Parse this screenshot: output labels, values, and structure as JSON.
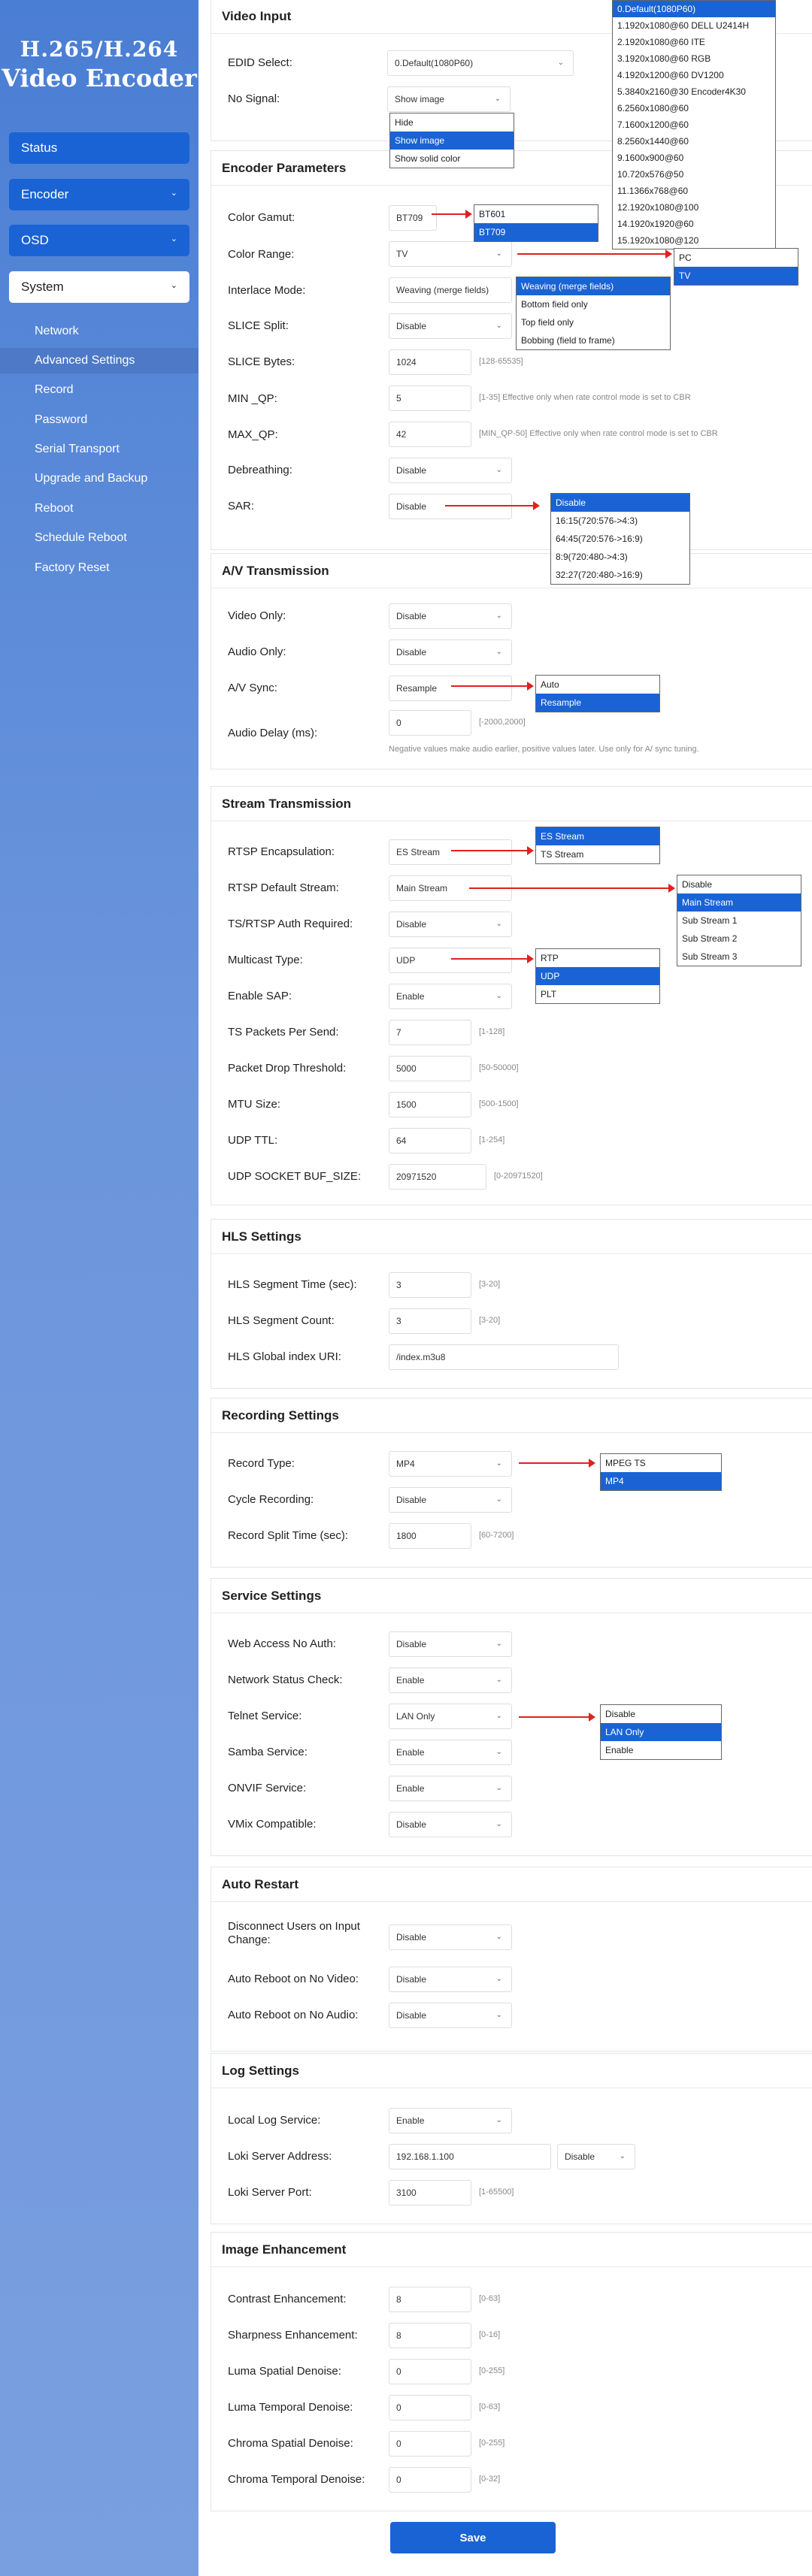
{
  "brand": {
    "line1": "H.265/H.264",
    "line2": "Video Encoder"
  },
  "nav": {
    "status": "Status",
    "encoder": "Encoder",
    "osd": "OSD",
    "system": "System",
    "sub": [
      "Network",
      "Advanced Settings",
      "Record",
      "Password",
      "Serial Transport",
      "Upgrade and Backup",
      "Reboot",
      "Schedule Reboot",
      "Factory Reset"
    ]
  },
  "video_input": {
    "title": "Video Input",
    "edid_label": "EDID Select:",
    "edid_value": "0.Default(1080P60)",
    "nosignal_label": "No Signal:",
    "nosignal_value": "Show image",
    "edid_options": [
      "0.Default(1080P60)",
      "1.1920x1080@60 DELL U2414H",
      "2.1920x1080@60 ITE",
      "3.1920x1080@60 RGB",
      "4.1920x1200@60 DV1200",
      "5.3840x2160@30 Encoder4K30",
      "6.2560x1080@60",
      "7.1600x1200@60",
      "8.2560x1440@60",
      "9.1600x900@60",
      "10.720x576@50",
      "11.1366x768@60",
      "12.1920x1080@100",
      "14.1920x1920@60",
      "15.1920x1080@120"
    ],
    "nosignal_options": [
      "Hide",
      "Show image",
      "Show solid color"
    ]
  },
  "encoder": {
    "title": "Encoder Parameters",
    "gamut_label": "Color Gamut:",
    "gamut_value": "BT709",
    "gamut_options": [
      "BT601",
      "BT709"
    ],
    "range_label": "Color Range:",
    "range_value": "TV",
    "range_options": [
      "PC",
      "TV"
    ],
    "interlace_label": "Interlace Mode:",
    "interlace_value": "Weaving (merge fields)",
    "interlace_options": [
      "Weaving (merge fields)",
      "Bottom field only",
      "Top field only",
      "Bobbing (field to frame)"
    ],
    "slice_label": "SLICE Split:",
    "slice_value": "Disable",
    "slicebytes_label": "SLICE Bytes:",
    "slicebytes_value": "1024",
    "slicebytes_hint": "[128-65535]",
    "minqp_label": "MIN _QP:",
    "minqp_value": "5",
    "minqp_hint": "[1-35]  Effective only when rate control mode is set to CBR",
    "maxqp_label": "MAX_QP:",
    "maxqp_value": "42",
    "maxqp_hint": "[MIN_QP-50]  Effective only when rate control mode is set to CBR",
    "debreath_label": "Debreathing:",
    "debreath_value": "Disable",
    "sar_label": "SAR:",
    "sar_value": "Disable",
    "sar_options": [
      "Disable",
      "16:15(720:576->4:3)",
      "64:45(720:576->16:9)",
      "8:9(720:480->4:3)",
      "32:27(720:480->16:9)"
    ]
  },
  "av": {
    "title": "A/V Transmission",
    "video_only_label": "Video Only:",
    "video_only_value": "Disable",
    "audio_only_label": "Audio Only:",
    "audio_only_value": "Disable",
    "sync_label": "A/V Sync:",
    "sync_value": "Resample",
    "sync_options": [
      "Auto",
      "Resample"
    ],
    "delay_label": "Audio Delay (ms):",
    "delay_value": "0",
    "delay_hint": "[-2000,2000]",
    "delay_note": "Negative values make audio earlier, positive values later. Use only for A/ sync tuning."
  },
  "stream": {
    "title": "Stream Transmission",
    "rtsp_encap_label": "RTSP Encapsulation:",
    "rtsp_encap_value": "ES Stream",
    "rtsp_encap_options": [
      "ES Stream",
      "TS Stream"
    ],
    "rtsp_default_label": "RTSP Default Stream:",
    "rtsp_default_value": "Main Stream",
    "rtsp_default_options": [
      "Disable",
      "Main Stream",
      "Sub Stream 1",
      "Sub Stream 2",
      "Sub Stream 3"
    ],
    "auth_label": "TS/RTSP Auth Required:",
    "auth_value": "Disable",
    "multicast_label": "Multicast Type:",
    "multicast_value": "UDP",
    "multicast_options": [
      "RTP",
      "UDP",
      "PLT"
    ],
    "sap_label": "Enable SAP:",
    "sap_value": "Enable",
    "tspkt_label": "TS Packets Per Send:",
    "tspkt_value": "7",
    "tspkt_hint": "[1-128]",
    "drop_label": "Packet Drop Threshold:",
    "drop_value": "5000",
    "drop_hint": "[50-50000]",
    "mtu_label": "MTU Size:",
    "mtu_value": "1500",
    "mtu_hint": "[500-1500]",
    "ttl_label": "UDP TTL:",
    "ttl_value": "64",
    "ttl_hint": "[1-254]",
    "buf_label": "UDP SOCKET BUF_SIZE:",
    "buf_value": "20971520",
    "buf_hint": "[0-20971520]"
  },
  "hls": {
    "title": "HLS Settings",
    "seg_time_label": "HLS Segment Time (sec):",
    "seg_time_value": "3",
    "seg_time_hint": "[3-20]",
    "seg_count_label": "HLS Segment Count:",
    "seg_count_value": "3",
    "seg_count_hint": "[3-20]",
    "uri_label": "HLS Global index URI:",
    "uri_value": "/index.m3u8"
  },
  "recording": {
    "title": "Recording Settings",
    "type_label": "Record Type:",
    "type_value": "MP4",
    "type_options": [
      "MPEG TS",
      "MP4"
    ],
    "cycle_label": "Cycle Recording:",
    "cycle_value": "Disable",
    "split_label": "Record Split Time (sec):",
    "split_value": "1800",
    "split_hint": "[60-7200]"
  },
  "service": {
    "title": "Service Settings",
    "web_label": "Web Access No Auth:",
    "web_value": "Disable",
    "netcheck_label": "Network Status Check:",
    "netcheck_value": "Enable",
    "telnet_label": "Telnet Service:",
    "telnet_value": "LAN Only",
    "telnet_options": [
      "Disable",
      "LAN Only",
      "Enable"
    ],
    "samba_label": "Samba Service:",
    "samba_value": "Enable",
    "onvif_label": "ONVIF Service:",
    "onvif_value": "Enable",
    "vmix_label": "VMix Compatible:",
    "vmix_value": "Disable"
  },
  "restart": {
    "title": "Auto Restart",
    "disc_label_1": "Disconnect Users on Input",
    "disc_label_2": "Change:",
    "disc_value": "Disable",
    "novideo_label": "Auto Reboot on No Video:",
    "novideo_value": "Disable",
    "noaudio_label": "Auto Reboot on No Audio:",
    "noaudio_value": "Disable"
  },
  "log": {
    "title": "Log Settings",
    "local_label": "Local Log Service:",
    "local_value": "Enable",
    "loki_addr_label": "Loki Server Address:",
    "loki_addr_value": "192.168.1.100",
    "loki_toggle_value": "Disable",
    "loki_port_label": "Loki Server Port:",
    "loki_port_value": "3100",
    "loki_port_hint": "[1-65500]"
  },
  "image": {
    "title": "Image Enhancement",
    "contrast_label": "Contrast Enhancement:",
    "contrast_value": "8",
    "contrast_hint": "[0-63]",
    "sharp_label": "Sharpness Enhancement:",
    "sharp_value": "8",
    "sharp_hint": "[0-16]",
    "lsd_label": "Luma Spatial Denoise:",
    "lsd_value": "0",
    "lsd_hint": "[0-255]",
    "ltd_label": "Luma Temporal Denoise:",
    "ltd_value": "0",
    "ltd_hint": "[0-63]",
    "csd_label": "Chroma Spatial Denoise:",
    "csd_value": "0",
    "csd_hint": "[0-255]",
    "ctd_label": "Chroma Temporal Denoise:",
    "ctd_value": "0",
    "ctd_hint": "[0-32]"
  },
  "save_label": "Save"
}
